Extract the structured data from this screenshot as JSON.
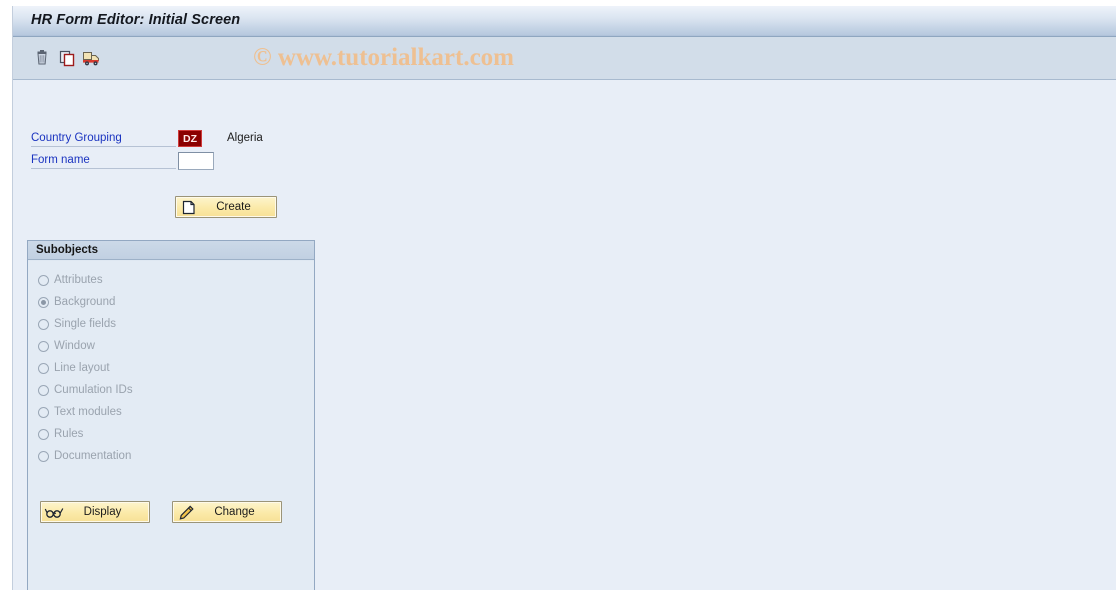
{
  "window": {
    "title": "HR Form Editor: Initial Screen"
  },
  "toolbar": {
    "buttons": [
      {
        "name": "delete",
        "icon": "trash-icon",
        "tooltip": "Delete"
      },
      {
        "name": "copy",
        "icon": "copy-icon",
        "tooltip": "Copy"
      },
      {
        "name": "transport",
        "icon": "truck-icon",
        "tooltip": "Transport"
      }
    ]
  },
  "watermark": {
    "text": "© www.tutorialkart.com",
    "color": "#eec092"
  },
  "selection": {
    "fields": [
      {
        "label": "Country Grouping",
        "value": "DZ",
        "description": "Algeria",
        "input_type": "key",
        "bg_color": "#8b0000"
      },
      {
        "label": "Form name",
        "value": "",
        "placeholder": "",
        "input_type": "text"
      }
    ]
  },
  "actions": {
    "create_label": "Create"
  },
  "subobjects": {
    "title": "Subobjects",
    "selected": "Background",
    "options": [
      {
        "label": "Attributes",
        "selected": false,
        "enabled": false
      },
      {
        "label": "Background",
        "selected": true,
        "enabled": false
      },
      {
        "label": "Single fields",
        "selected": false,
        "enabled": false
      },
      {
        "label": "Window",
        "selected": false,
        "enabled": false
      },
      {
        "label": "Line layout",
        "selected": false,
        "enabled": false
      },
      {
        "label": "Cumulation IDs",
        "selected": false,
        "enabled": false
      },
      {
        "label": "Text modules",
        "selected": false,
        "enabled": false
      },
      {
        "label": "Rules",
        "selected": false,
        "enabled": false
      },
      {
        "label": "Documentation",
        "selected": false,
        "enabled": false
      }
    ],
    "display_label": "Display",
    "change_label": "Change"
  }
}
